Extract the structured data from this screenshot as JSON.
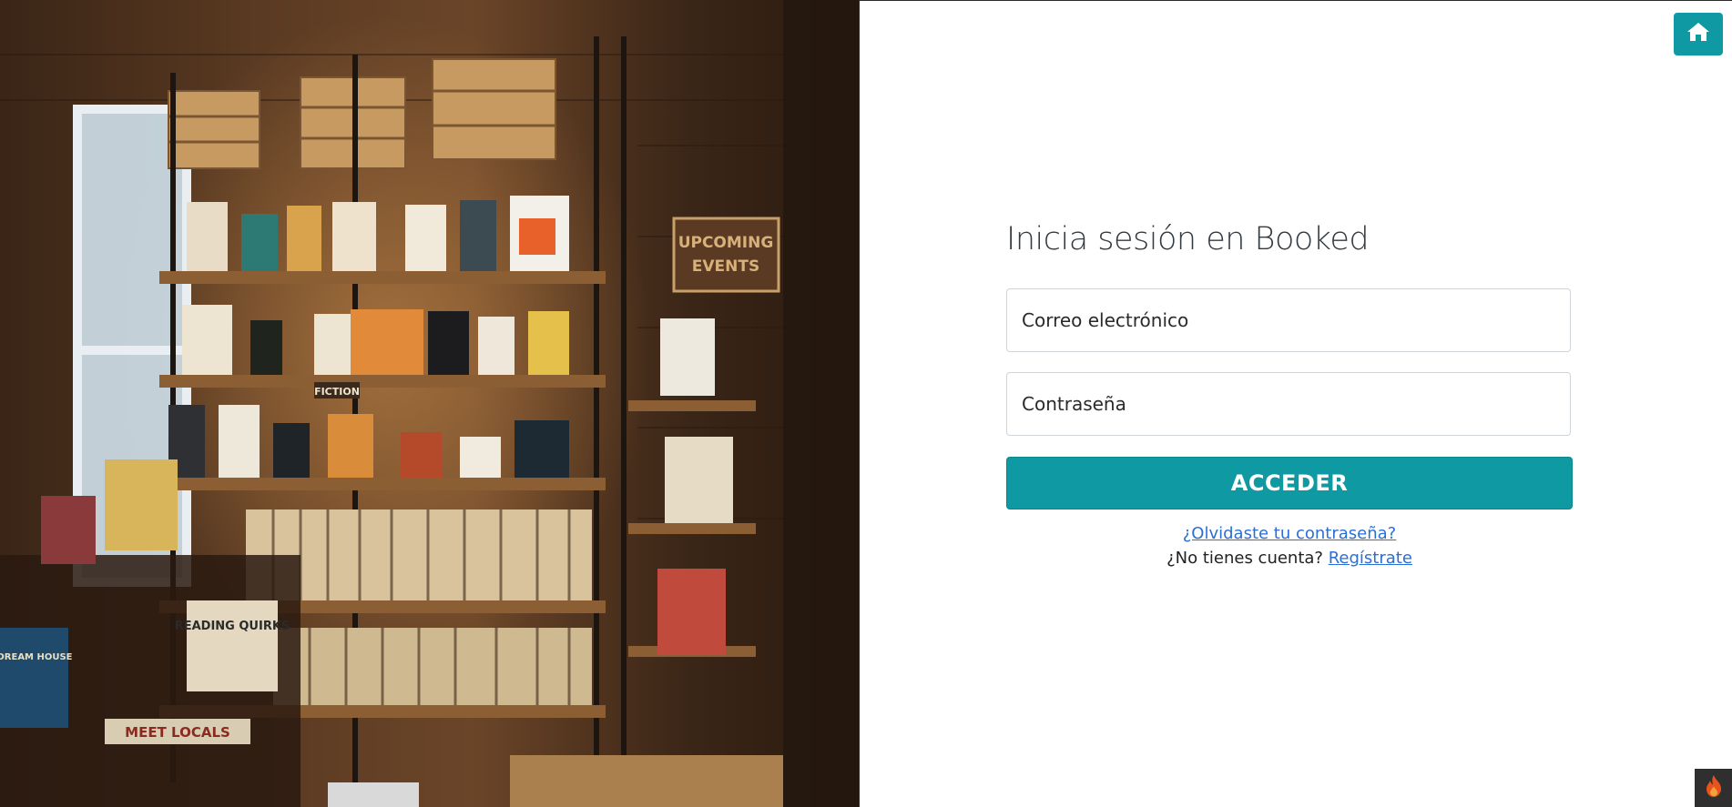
{
  "login": {
    "title": "Inicia sesión en Booked",
    "email_placeholder": "Correo electrónico",
    "password_placeholder": "Contraseña",
    "submit_label": "ACCEDER",
    "forgot_link": "¿Olvidaste tu contraseña?",
    "no_account_text": "¿No tienes cuenta?",
    "register_link": "Regístrate"
  },
  "photo": {
    "sign_text_line1": "UPCOMING",
    "sign_text_line2": "EVENTS",
    "book_title_1": "READING QUIRKS",
    "book_title_2": "DREAM HOUSE",
    "shelf_label": "FICTION",
    "shelf_sign": "MEET LOCALS"
  },
  "icons": {
    "home": "home-icon",
    "badge": "flame-icon"
  },
  "colors": {
    "accent": "#0f9aa3",
    "link": "#2a6fd6",
    "badge_bg": "#2f2f2f",
    "badge_flame": "#e8531c"
  }
}
